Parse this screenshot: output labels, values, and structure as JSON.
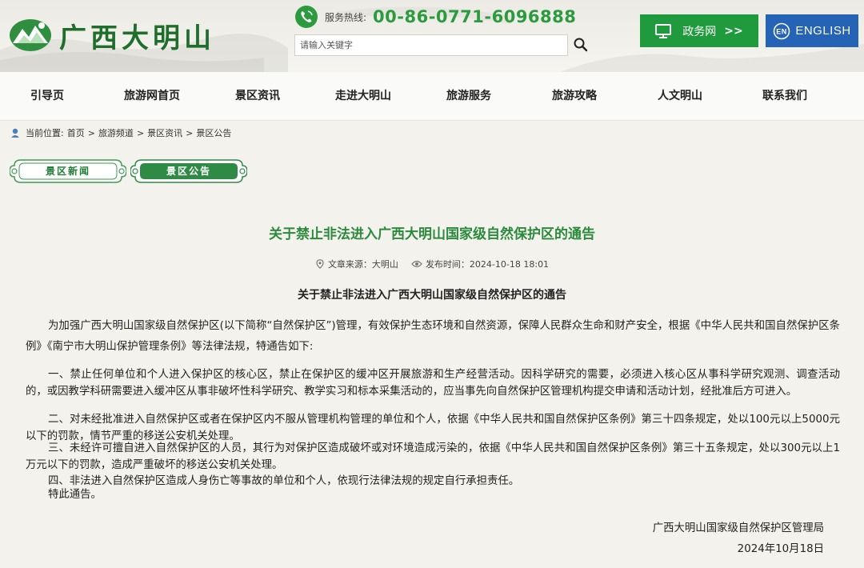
{
  "header": {
    "logo_text": "广西大明山",
    "hotline_label": "服务热线:",
    "hotline_number": "00-86-0771-6096888",
    "search_placeholder": "请输入关键字",
    "gov_button": "政务网",
    "gov_arrows": ">>",
    "english_button": "ENGLISH",
    "english_badge": "EN"
  },
  "nav": {
    "items": [
      "引导页",
      "旅游网首页",
      "景区资讯",
      "走进大明山",
      "旅游服务",
      "旅游攻略",
      "人文明山",
      "联系我们"
    ]
  },
  "breadcrumb": {
    "label": "当前位置:",
    "items": [
      "首页",
      "旅游频道",
      "景区资讯",
      "景区公告"
    ],
    "separator": ">"
  },
  "tabs": {
    "news": "景区新闻",
    "notice": "景区公告"
  },
  "article": {
    "title": "关于禁止非法进入广西大明山国家级自然保护区的通告",
    "source": "文章来源：大明山",
    "time": "发布时间：2024-10-18 18:01",
    "subtitle": "关于禁止非法进入广西大明山国家级自然保护区的通告",
    "intro": "为加强广西大明山国家级自然保护区(以下简称“自然保护区”)管理，有效保护生态环境和自然资源，保障人民群众生命和财产安全，根据《中华人民共和国自然保护区条例》《南宁市大明山保护管理条例》等法律法规，特通告如下:",
    "p1": "一、禁止任何单位和个人进入保护区的核心区，禁止在保护区的缓冲区开展旅游和生产经营活动。因科学研究的需要，必须进入核心区从事科学研究观测、调查活动的，或因教学科研需要进入缓冲区从事非破坏性科学研究、教学实习和标本采集活动的，应当事先向自然保护区管理机构提交申请和活动计划，经批准后方可进入。",
    "p2": "二、对未经批准进入自然保护区或者在保护区内不服从管理机构管理的单位和个人，依据《中华人民共和国自然保护区条例》第三十四条规定，处以100元以上5000元以下的罚款，情节严重的移送公安机关处理。",
    "p3": "三、未经许可擅自进入自然保护区的人员，其行为对保护区造成破坏或对环境造成污染的，依据《中华人民共和国自然保护区条例》第三十五条规定，处以300元以上1万元以下的罚款，造成严重破坏的移送公安机关处理。",
    "p4": "四、非法进入自然保护区造成人身伤亡等事故的单位和个人，依现行法律法规的规定自行承担责任。",
    "p5": "特此通告。",
    "sign_org": "广西大明山国家级自然保护区管理局",
    "sign_date": "2024年10月18日"
  },
  "colors": {
    "brand_green": "#1f9a3c",
    "title_green": "#2b8a3e",
    "english_blue": "#2563b6"
  }
}
